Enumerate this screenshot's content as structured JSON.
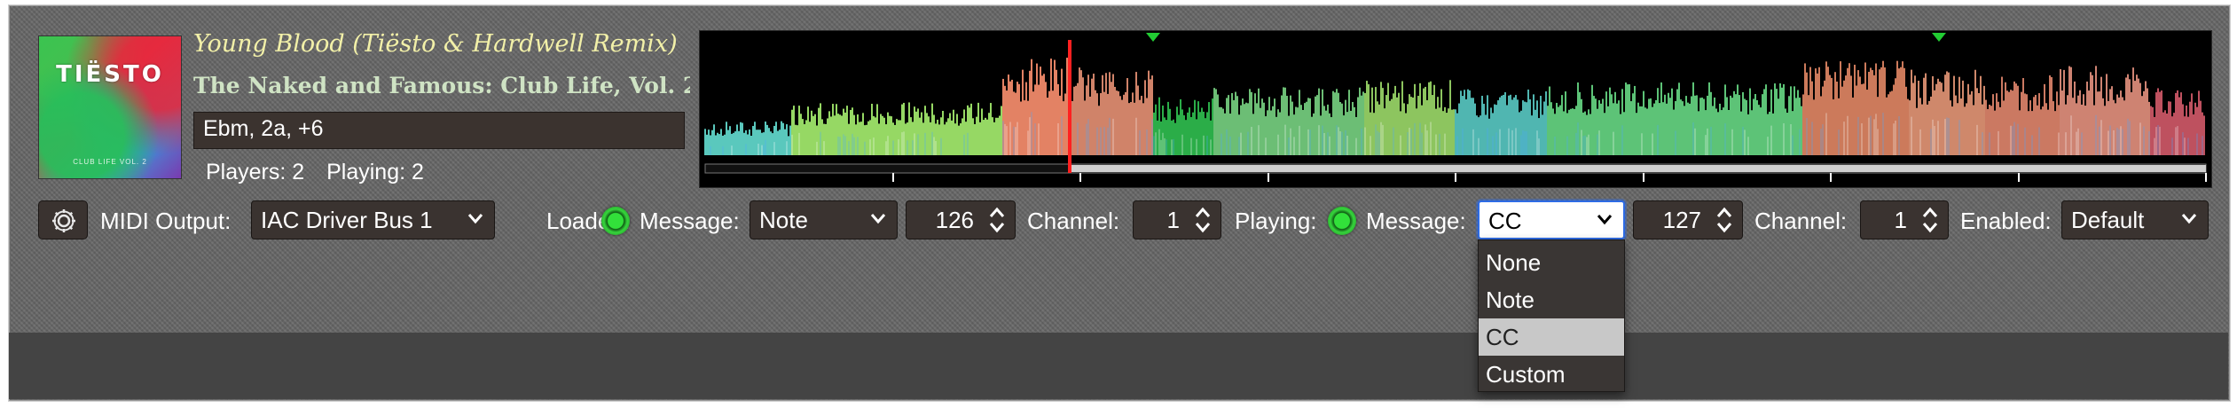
{
  "track": {
    "title": "Young Blood (Tiësto & Hardwell Remix)",
    "album": "The Naked and Famous: Club Life, Vol. 2...",
    "meta": "Ebm, 2a, +6",
    "artwork_text": "TIËSTO",
    "artwork_caption": "CLUB LIFE VOL. 2"
  },
  "players": {
    "players_label": "Players: 2",
    "playing_label": "Playing: 2"
  },
  "waveform": {
    "played_fraction": 0.245,
    "cue_markers": [
      "green-triangle",
      "green-triangle"
    ],
    "colors": {
      "background": "#000000",
      "playhead": "#ff2020",
      "cue": "#22cc33"
    }
  },
  "controls": {
    "settings_icon": "gear-icon",
    "midi_output_label": "MIDI Output:",
    "midi_output_value": "IAC Driver Bus 1",
    "loaded_label": "Loaded:",
    "loaded_message_label": "Message:",
    "loaded_message_value": "Note",
    "loaded_note_value": "126",
    "loaded_channel_label": "Channel:",
    "loaded_channel_value": "1",
    "playing_label": "Playing:",
    "playing_message_label": "Message:",
    "playing_message_value": "CC",
    "playing_cc_value": "127",
    "playing_channel_label": "Channel:",
    "playing_channel_value": "1",
    "enabled_label": "Enabled:",
    "enabled_value": "Default"
  },
  "message_menu": {
    "options": [
      "None",
      "Note",
      "CC",
      "Custom"
    ],
    "selected": "CC"
  },
  "theme": {
    "indicator_green": "#22dd33",
    "focus_blue": "#2d6be5"
  }
}
